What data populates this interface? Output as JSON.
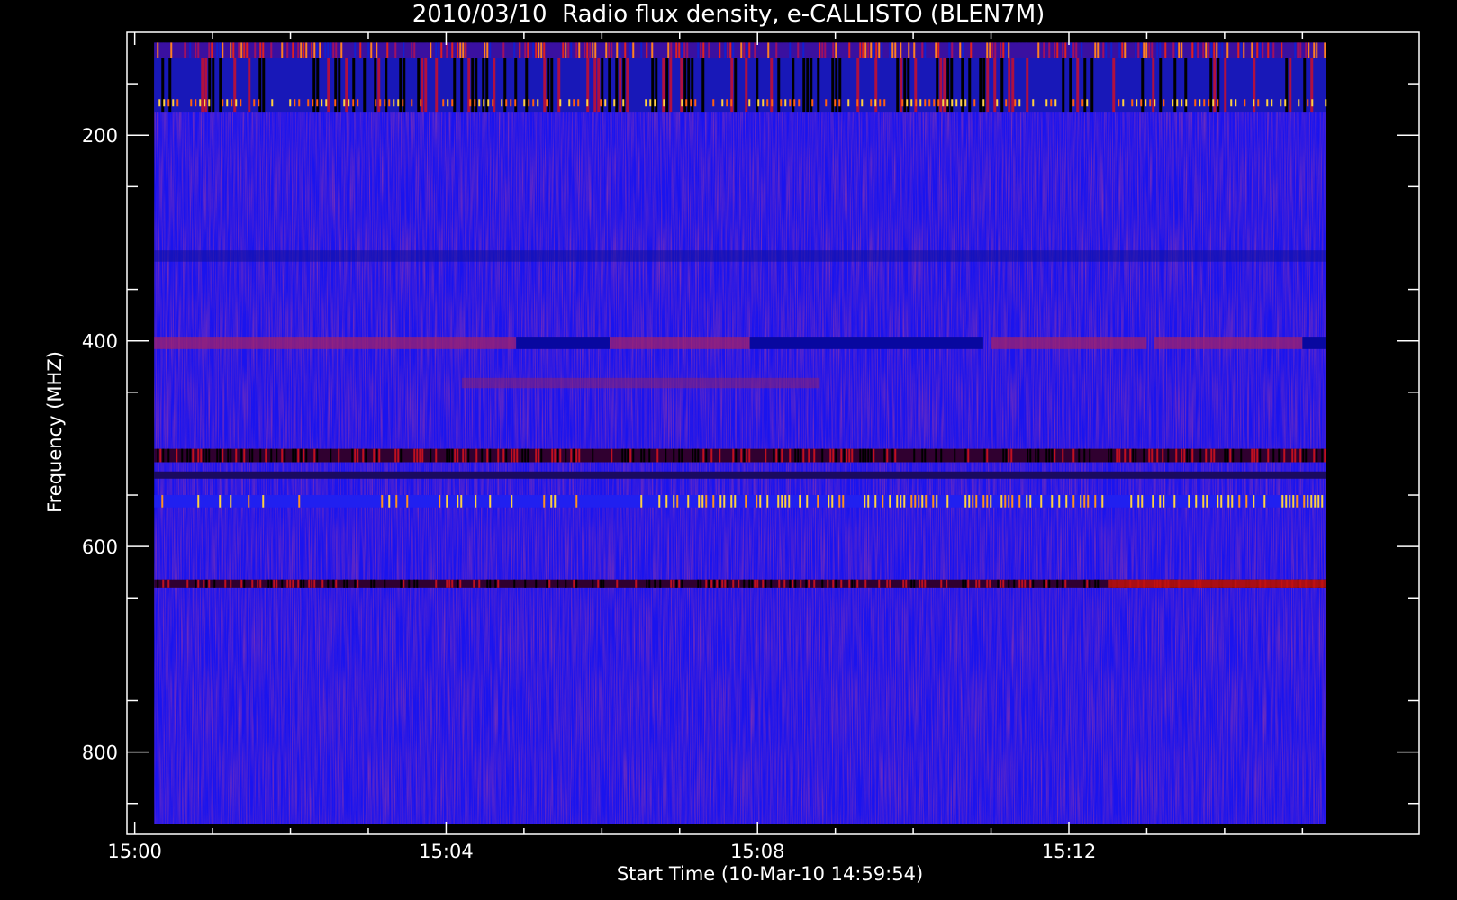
{
  "chart_data": {
    "type": "heatmap",
    "title": "2010/03/10  Radio flux density, e-CALLISTO (BLEN7M)",
    "xlabel": "Start Time (10-Mar-10 14:59:54)",
    "ylabel": "Frequency (MHZ)",
    "x_ticks": [
      "15:00",
      "15:04",
      "15:08",
      "15:12"
    ],
    "y_ticks": [
      "200",
      "400",
      "600",
      "800"
    ],
    "x_range_minutes_after_1500": [
      -0.1,
      16.5
    ],
    "data_time_range_minutes_after_1500": [
      0.25,
      15.3
    ],
    "ylim": [
      880,
      100
    ],
    "data_freq_range_mhz": [
      870,
      110
    ],
    "colors": {
      "background": "#000000",
      "axes": "#ffffff",
      "base": "#1a14ee",
      "hot": "#ffd040",
      "warm": "#d01010"
    },
    "bands": [
      {
        "freq": [
          110,
          125
        ],
        "kind": "rfi-bursty"
      },
      {
        "freq": [
          125,
          178
        ],
        "kind": "rfi-dark-bursty"
      },
      {
        "freq": [
          165,
          172
        ],
        "kind": "hot-spikes"
      },
      {
        "freq": [
          312,
          323
        ],
        "kind": "dark-strip"
      },
      {
        "freq": [
          396,
          408
        ],
        "kind": "red-segments",
        "segments": [
          [
            0.25,
            4.9
          ],
          [
            6.1,
            7.9
          ],
          [
            11.0,
            13.0
          ],
          [
            13.1,
            15.0
          ]
        ]
      },
      {
        "freq": [
          396,
          408
        ],
        "kind": "dark-segments",
        "segments": [
          [
            4.9,
            6.1
          ],
          [
            7.9,
            10.9
          ],
          [
            15.0,
            15.3
          ]
        ]
      },
      {
        "freq": [
          436,
          446
        ],
        "kind": "faint-red",
        "segments": [
          [
            4.2,
            8.8
          ]
        ]
      },
      {
        "freq": [
          505,
          518
        ],
        "kind": "dark-red-stripe"
      },
      {
        "freq": [
          527,
          534
        ],
        "kind": "dark-stripe"
      },
      {
        "freq": [
          550,
          562
        ],
        "kind": "gold-spikes"
      },
      {
        "freq": [
          632,
          640
        ],
        "kind": "dark-red-stripe",
        "hot_segment": [
          12.5,
          15.3
        ]
      }
    ]
  }
}
